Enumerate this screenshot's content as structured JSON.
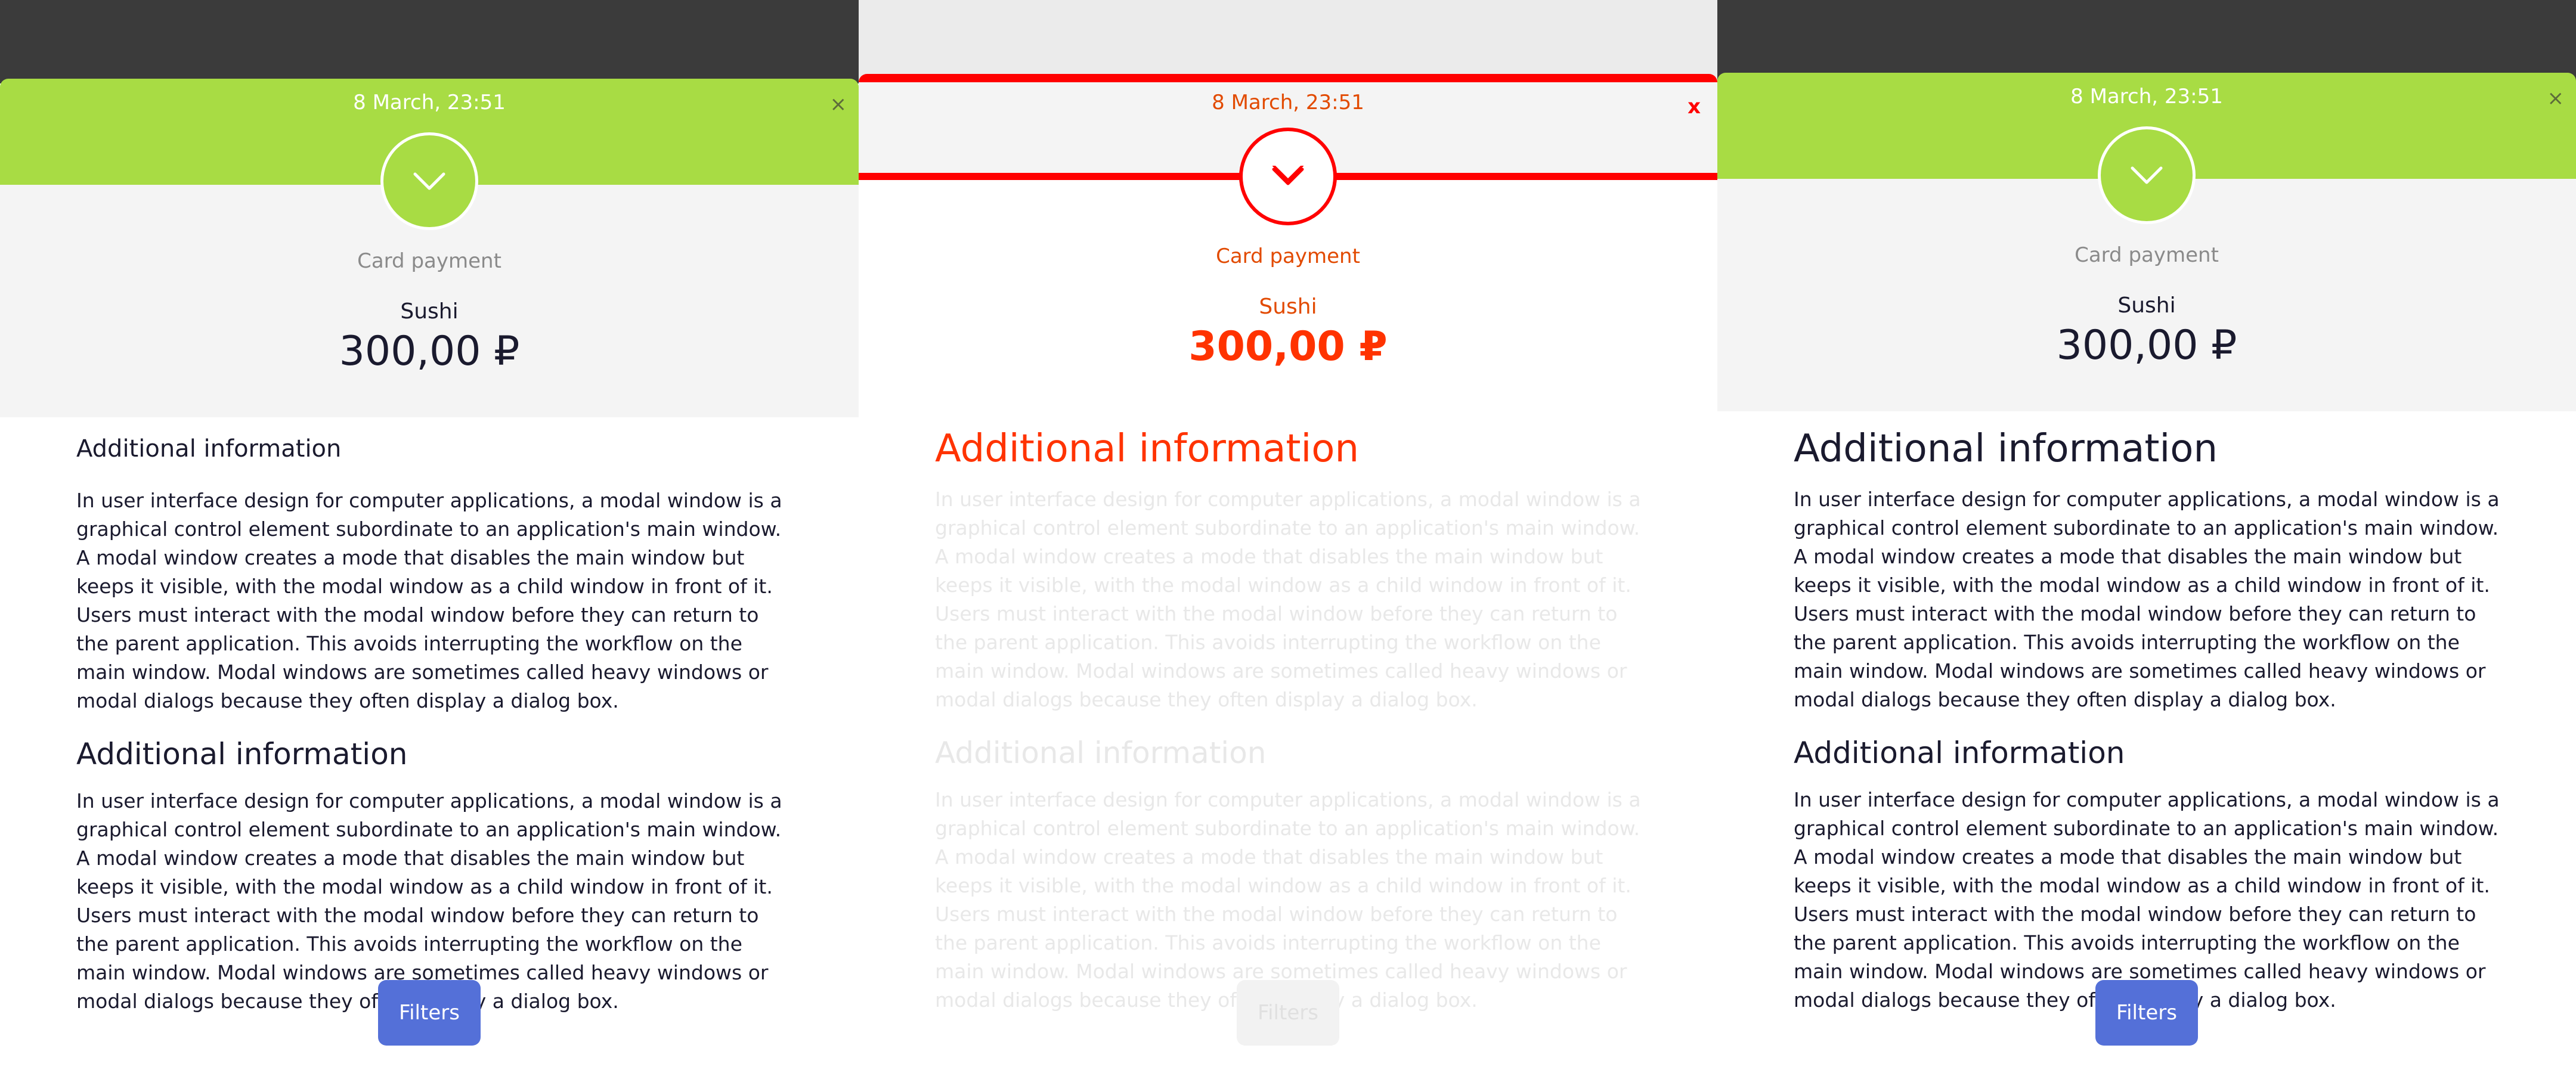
{
  "screens": [
    {
      "date": "8 March, 23:51",
      "close": "×",
      "payment_method": "Card payment",
      "product": "Sushi",
      "amount": "300,00 ₽",
      "heading_1": "Additional information",
      "paragraph_1": "In user interface design for computer applications, a modal window is a graphical control element subordinate to an application's main window. A modal window creates a mode that disables the main window but keeps it visible, with the modal window as a child window in front of it. Users must interact with the modal window before they can return to the parent application. This avoids interrupting the workflow on the main window. Modal windows are sometimes called heavy windows or modal dialogs because they often display a dialog box.",
      "heading_2": "Additional information",
      "paragraph_2": "In user interface design for computer applications, a modal window is a graphical control element subordinate to an application's main window. A modal window creates a mode that disables the main window but keeps it visible, with the modal window as a child window in front of it. Users must interact with the modal window before they can return to the parent application. This avoids interrupting the workflow on the main window. Modal windows are sometimes called heavy windows or modal dialogs because they often display a dialog box.",
      "filters_button": "Filters"
    },
    {
      "date": "8 March, 23:51",
      "close": "x",
      "payment_method": "Card payment",
      "product": "Sushi",
      "amount": "300,00 ₽",
      "heading_1": "Additional information",
      "paragraph_1": "In user interface design for computer applications, a modal window is a graphical control element subordinate to an application's main window. A modal window creates a mode that disables the main window but keeps it visible, with the modal window as a child window in front of it. Users must interact with the modal window before they can return to the parent application. This avoids interrupting the workflow on the main window. Modal windows are sometimes called heavy windows or modal dialogs because they often display a dialog box.",
      "heading_2": "Additional information",
      "paragraph_2": "In user interface design for computer applications, a modal window is a graphical control element subordinate to an application's main window. A modal window creates a mode that disables the main window but keeps it visible, with the modal window as a child window in front of it. Users must interact with the modal window before they can return to the parent application. This avoids interrupting the workflow on the main window. Modal windows are sometimes called heavy windows or modal dialogs because they often display a dialog box.",
      "filters_button": "Filters"
    },
    {
      "date": "8 March, 23:51",
      "close": "×",
      "payment_method": "Card payment",
      "product": "Sushi",
      "amount": "300,00 ₽",
      "heading_1": "Additional information",
      "paragraph_1": "In user interface design for computer applications, a modal window is a graphical control element subordinate to an application's main window. A modal window creates a mode that disables the main window but keeps it visible, with the modal window as a child window in front of it. Users must interact with the modal window before they can return to the parent application. This avoids interrupting the workflow on the main window. Modal windows are sometimes called heavy windows or modal dialogs because they often display a dialog box.",
      "heading_2": "Additional information",
      "paragraph_2": "In user interface design for computer applications, a modal window is a graphical control element subordinate to an application's main window. A modal window creates a mode that disables the main window but keeps it visible, with the modal window as a child window in front of it. Users must interact with the modal window before they can return to the parent application. This avoids interrupting the workflow on the main window. Modal windows are sometimes called heavy windows or modal dialogs because they often display a dialog box.",
      "filters_button": "Filters"
    }
  ],
  "colors": {
    "accent_green": "#a8dc44",
    "header_dark": "#3b3b3b",
    "button_blue": "#5470d8",
    "diff_red": "#ff0000",
    "diff_orange": "#e24a00",
    "text_dark": "#1a1a2e",
    "text_muted": "#8a8a8a"
  },
  "icons": {
    "expand": "chevron-down-icon",
    "close": "close-icon"
  }
}
